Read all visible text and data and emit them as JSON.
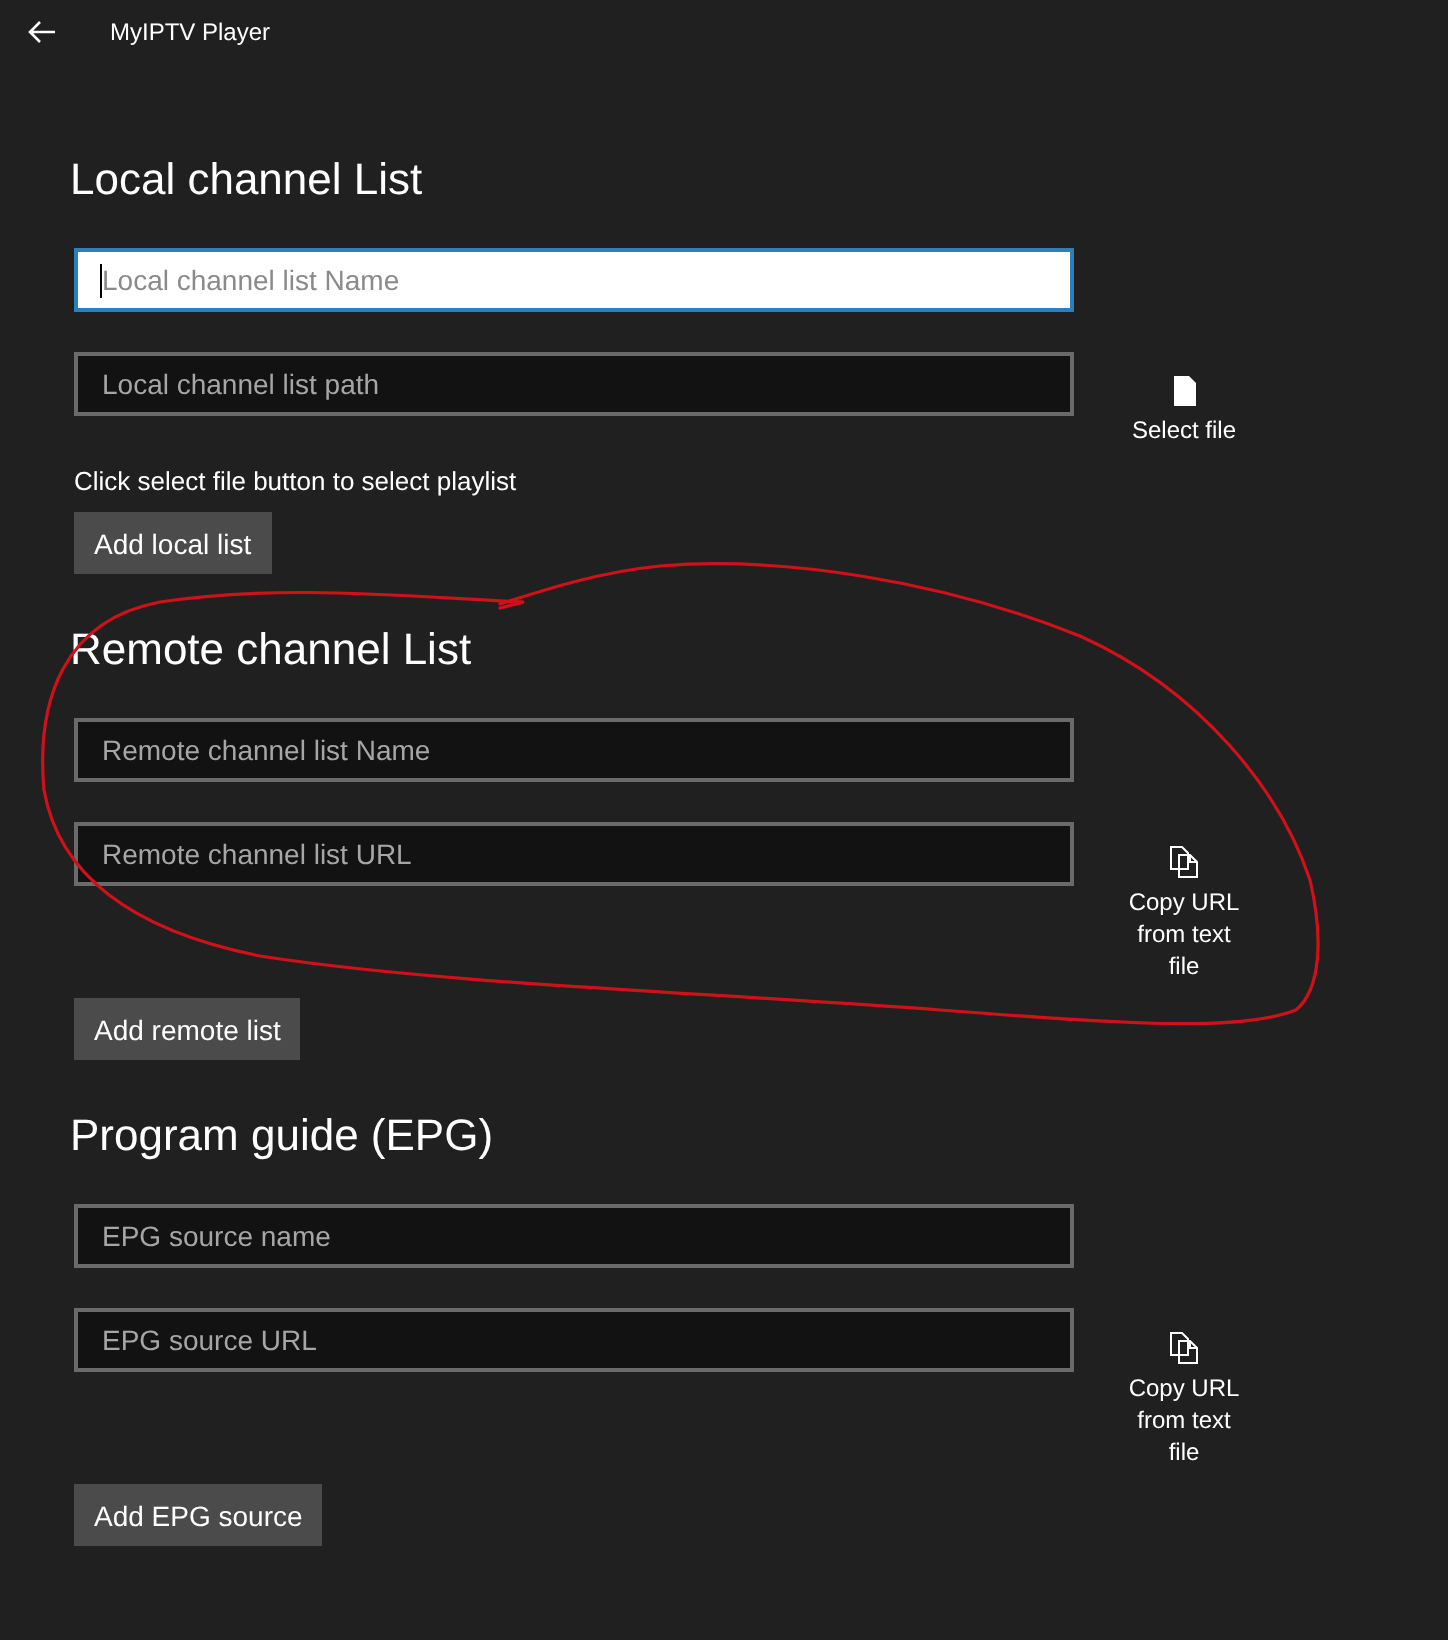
{
  "window": {
    "title": "MyIPTV Player"
  },
  "sections": [
    {
      "title": "Local channel List",
      "fields": [
        {
          "placeholder": "Local channel list Name",
          "focused": true
        },
        {
          "placeholder": "Local channel list path",
          "focused": false
        }
      ],
      "action": {
        "kind": "file",
        "label": "Select file"
      },
      "hint": "Click select file button to select playlist",
      "button": "Add local list"
    },
    {
      "title": "Remote channel List",
      "fields": [
        {
          "placeholder": "Remote channel list Name",
          "focused": false
        },
        {
          "placeholder": "Remote channel list URL",
          "focused": false
        }
      ],
      "action": {
        "kind": "copy",
        "label": "Copy URL from text file"
      },
      "button": "Add remote list"
    },
    {
      "title": "Program guide (EPG)",
      "fields": [
        {
          "placeholder": "EPG source name",
          "focused": false
        },
        {
          "placeholder": "EPG source URL",
          "focused": false
        }
      ],
      "action": {
        "kind": "copy",
        "label": "Copy URL from text file"
      },
      "button": "Add EPG source"
    }
  ]
}
